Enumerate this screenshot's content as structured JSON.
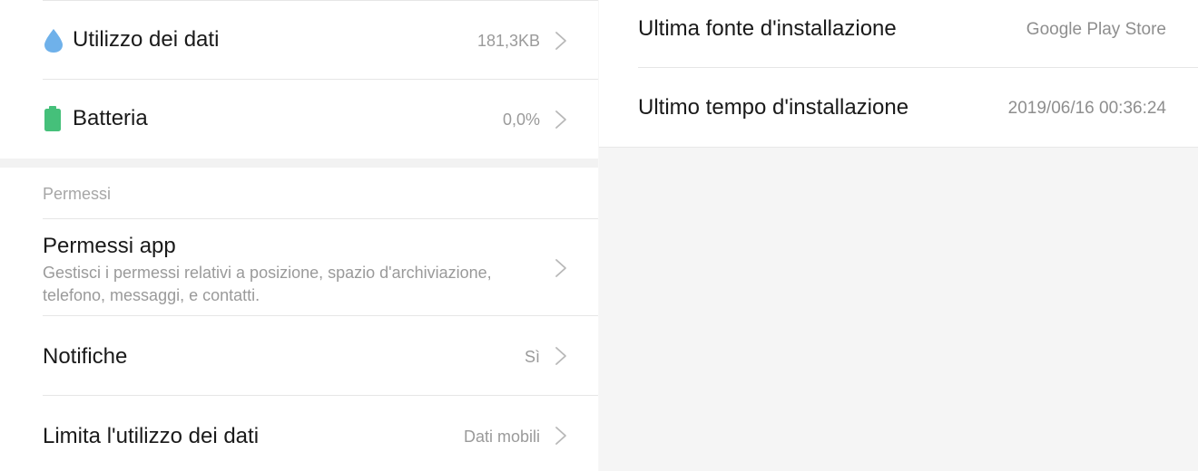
{
  "app_info": {
    "data_usage": {
      "label": "Utilizzo dei dati",
      "value": "181,3KB",
      "icon": "water-drop-icon",
      "icon_color": "#6fb1ea"
    },
    "battery": {
      "label": "Batteria",
      "value": "0,0%",
      "icon": "battery-icon",
      "icon_color": "#45c07a"
    }
  },
  "permissions": {
    "section_title": "Permessi",
    "app_permissions": {
      "label": "Permessi app",
      "description": "Gestisci i permessi relativi a posizione, spazio d'archiviazione, telefono, messaggi, e contatti."
    },
    "notifications": {
      "label": "Notifiche",
      "value": "Sì"
    },
    "data_limit": {
      "label": "Limita l'utilizzo dei dati",
      "value": "Dati mobili"
    }
  },
  "install_info": {
    "source": {
      "label": "Ultima fonte d'installazione",
      "value": "Google Play Store"
    },
    "time": {
      "label": "Ultimo tempo d'installazione",
      "value": "2019/06/16 00:36:24"
    }
  }
}
